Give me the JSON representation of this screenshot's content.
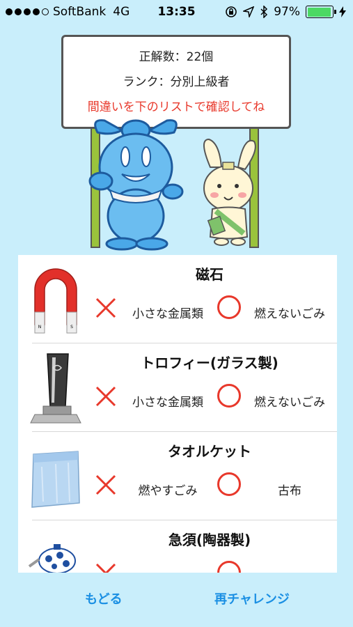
{
  "status_bar": {
    "carrier": "SoftBank",
    "network": "4G",
    "time": "13:35",
    "battery": "97%",
    "battery_level": 0.97,
    "signal_bars": 4
  },
  "sign": {
    "score": "正解数：22個",
    "rank": "ランク：分別上級者",
    "instruction": "間違いを下のリストで確認してね"
  },
  "results": [
    {
      "title": "磁石",
      "wrong": "小さな金属類",
      "correct": "燃えないごみ",
      "image": "magnet"
    },
    {
      "title": "トロフィー(ガラス製)",
      "wrong": "小さな金属類",
      "correct": "燃えないごみ",
      "image": "trophy"
    },
    {
      "title": "タオルケット",
      "wrong": "燃やすごみ",
      "correct": "古布",
      "image": "towel-blanket"
    },
    {
      "title": "急須(陶器製)",
      "wrong": "",
      "correct": "",
      "image": "teapot"
    }
  ],
  "nav": {
    "back": "もどる",
    "retry": "再チャレンジ"
  },
  "colors": {
    "background": "#c9eefb",
    "accent": "#1a8fe3",
    "mark": "#e8382b"
  }
}
